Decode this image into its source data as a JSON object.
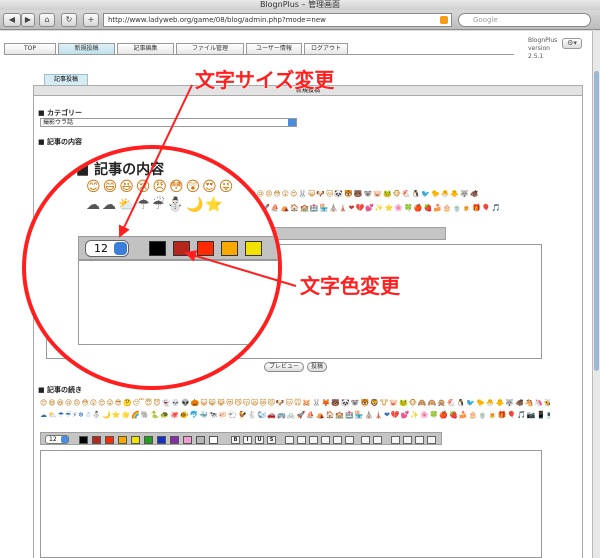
{
  "window": {
    "title": "BlognPlus – 管理画面"
  },
  "browser": {
    "url": "http://www.ladyweb.org/game/08/blog/admin.php?mode=new",
    "search_placeholder": "Google",
    "add_label": "+"
  },
  "nav": {
    "tabs": [
      "TOP",
      "新規投稿",
      "記事編集",
      "ファイル管理",
      "ユーザー情報",
      "ログアウト"
    ],
    "active": 1
  },
  "version": {
    "name": "BlognPlus",
    "label": "version",
    "number": "2.5.1"
  },
  "form": {
    "tab_label": "記事投稿",
    "header": "新規投稿",
    "category_label": "■ カテゴリー",
    "category_value": "撮影ウラ話",
    "content_label": "■ 記事の内容",
    "continue_label": "■ 記事の続き",
    "preview_button": "プレビュー",
    "submit_button": "投稿"
  },
  "toolbar": {
    "font_size": "12",
    "colors": [
      "#000000",
      "#b5271c",
      "#ff2a00",
      "#f7a900",
      "#f2e200",
      "#1ea21e",
      "#1432c8",
      "#8a2ba8",
      "#f49ad0",
      "#b8b8b8",
      "#ffffff"
    ],
    "format_buttons": [
      "B",
      "I",
      "U",
      "S"
    ]
  },
  "annotations": {
    "font_size_change": "文字サイズ変更",
    "font_color_change": "文字色変更"
  },
  "colors": {
    "annotation": "#ff1f1f",
    "accent": "#4a8de0"
  }
}
